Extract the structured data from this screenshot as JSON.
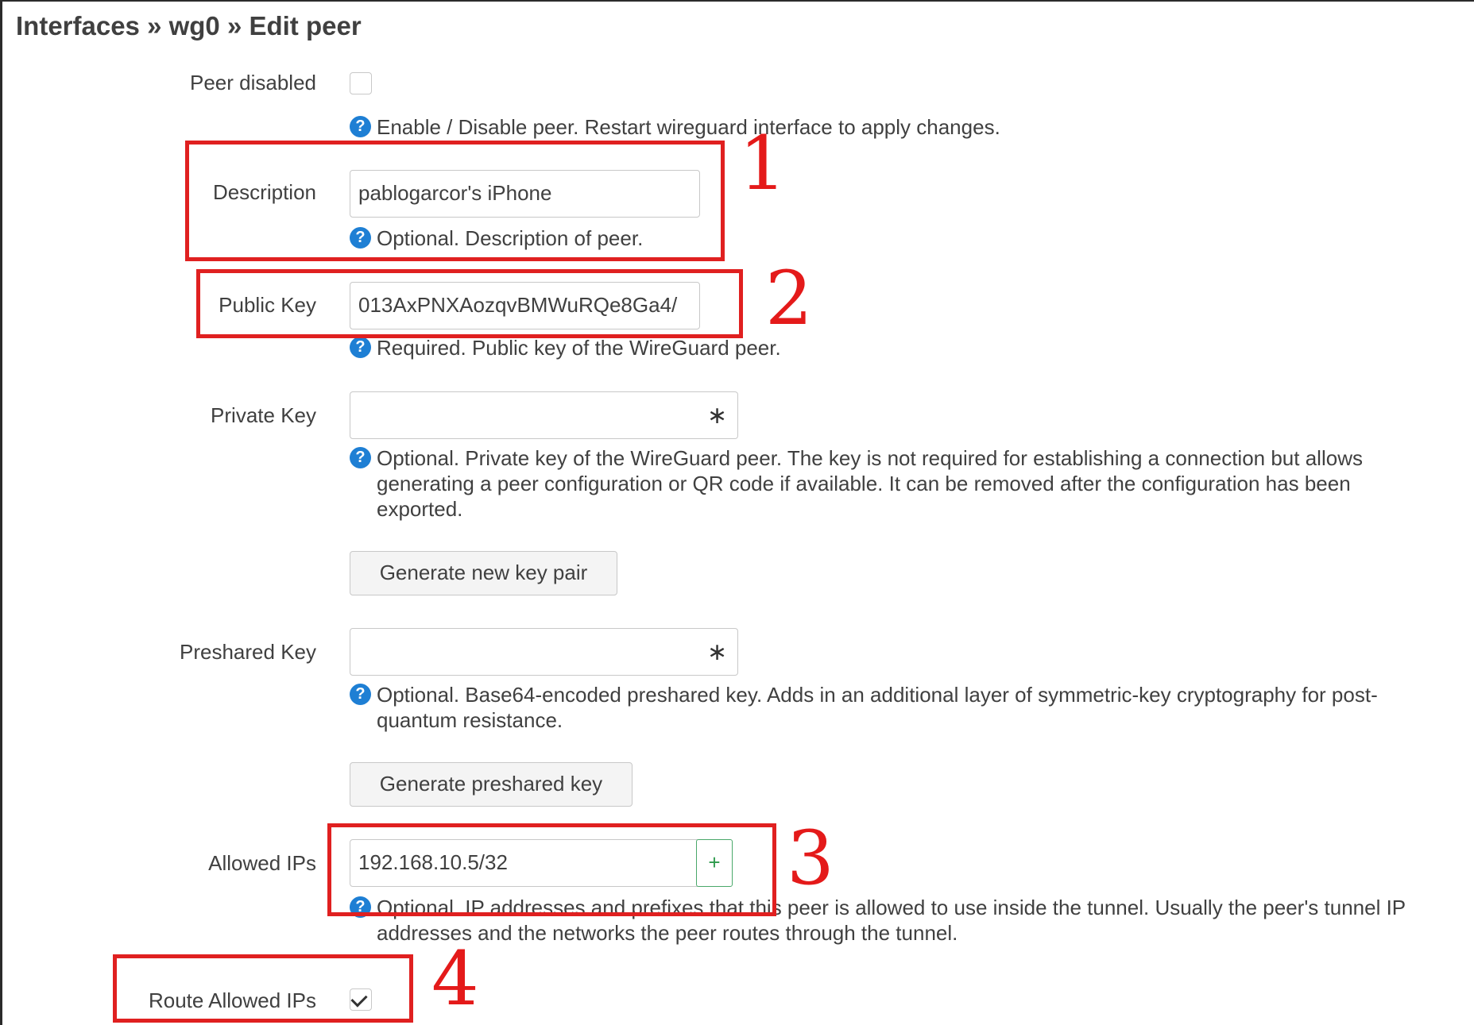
{
  "breadcrumb": "Interfaces » wg0 » Edit peer",
  "fields": {
    "peer_disabled": {
      "label": "Peer disabled",
      "checked": false,
      "help": "Enable / Disable peer. Restart wireguard interface to apply changes."
    },
    "description": {
      "label": "Description",
      "value": "pablogarcor's iPhone",
      "help": "Optional. Description of peer."
    },
    "public_key": {
      "label": "Public Key",
      "value": "013AxPNXAozqvBMWuRQe8Ga4/",
      "help": "Required. Public key of the WireGuard peer."
    },
    "private_key": {
      "label": "Private Key",
      "value": "",
      "toggle_glyph": "∗",
      "help_lines": [
        "Optional. Private key of the WireGuard peer. The key is not required for establishing a connection but allows",
        "generating a peer configuration or QR code if available. It can be removed after the configuration has been",
        "exported."
      ],
      "button": "Generate new key pair"
    },
    "preshared_key": {
      "label": "Preshared Key",
      "value": "",
      "toggle_glyph": "∗",
      "help_lines": [
        "Optional. Base64-encoded preshared key. Adds in an additional layer of symmetric-key cryptography for post-",
        "quantum resistance."
      ],
      "button": "Generate preshared key"
    },
    "allowed_ips": {
      "label": "Allowed IPs",
      "value": "192.168.10.5/32",
      "add_glyph": "+",
      "help_lines": [
        "Optional. IP addresses and prefixes that this peer is allowed to use inside the tunnel. Usually the peer's tunnel IP",
        "addresses and the networks the peer routes through the tunnel."
      ]
    },
    "route_allowed_ips": {
      "label": "Route Allowed IPs",
      "checked": true
    }
  },
  "help_icon": "question-circle-icon",
  "annotations": {
    "color": "#e02020",
    "markers": [
      "1",
      "2",
      "3",
      "4"
    ]
  }
}
